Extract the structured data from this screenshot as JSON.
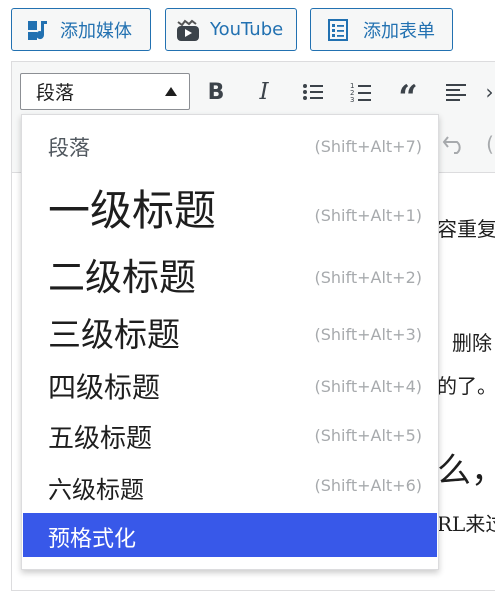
{
  "media_buttons": {
    "add_media": "添加媒体",
    "youtube": "YouTube",
    "add_form": "添加表单"
  },
  "toolbar": {
    "format_select_value": "段落",
    "icons": [
      "bold-icon",
      "italic-icon",
      "bulleted-list-icon",
      "numbered-list-icon",
      "blockquote-icon",
      "align-left-icon"
    ]
  },
  "content_fragments": {
    "line1": "容重复",
    "line2": "删除",
    "line3": "的了。",
    "line4": "么，",
    "line5": "RL来过"
  },
  "format_menu": {
    "items": [
      {
        "label": "段落",
        "shortcut": "(Shift+Alt+7)"
      },
      {
        "label": "一级标题",
        "shortcut": "(Shift+Alt+1)"
      },
      {
        "label": "二级标题",
        "shortcut": "(Shift+Alt+2)"
      },
      {
        "label": "三级标题",
        "shortcut": "(Shift+Alt+3)"
      },
      {
        "label": "四级标题",
        "shortcut": "(Shift+Alt+4)"
      },
      {
        "label": "五级标题",
        "shortcut": "(Shift+Alt+5)"
      },
      {
        "label": "六级标题",
        "shortcut": "(Shift+Alt+6)"
      },
      {
        "label": "预格式化",
        "shortcut": ""
      }
    ],
    "selected_index": 7
  },
  "colors": {
    "accent": "#2271b1",
    "selected_bg": "#3858e9",
    "shortcut_text": "#a7aaad"
  }
}
